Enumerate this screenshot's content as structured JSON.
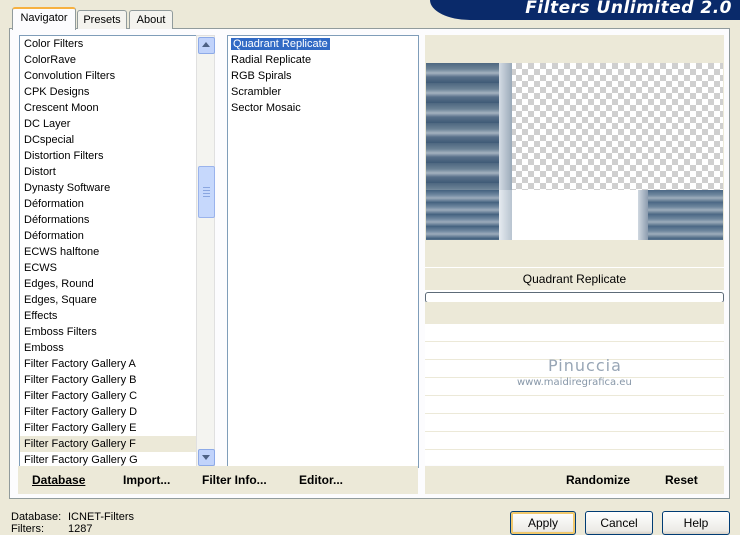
{
  "banner": {
    "title": "Filters Unlimited 2.0"
  },
  "tabs": [
    {
      "label": "Navigator",
      "active": true
    },
    {
      "label": "Presets",
      "active": false
    },
    {
      "label": "About",
      "active": false
    }
  ],
  "categories": [
    "Color Filters",
    "ColorRave",
    "Convolution Filters",
    "CPK Designs",
    "Crescent Moon",
    "DC Layer",
    "DCspecial",
    "Distortion Filters",
    "Distort",
    "Dynasty Software",
    "Déformation",
    "Déformations",
    "Déformation",
    "ECWS halftone",
    "ECWS",
    "Edges, Round",
    "Edges, Square",
    "Effects",
    "Emboss Filters",
    "Emboss",
    "Filter Factory Gallery A",
    "Filter Factory Gallery B",
    "Filter Factory Gallery C",
    "Filter Factory Gallery D",
    "Filter Factory Gallery E",
    "Filter Factory Gallery F",
    "Filter Factory Gallery G"
  ],
  "selected_category": "Filter Factory Gallery F",
  "filters": [
    "Quadrant Replicate",
    "Radial Replicate",
    "RGB Spirals",
    "Scrambler",
    "Sector Mosaic"
  ],
  "selected_filter": "Quadrant Replicate",
  "toolbar": {
    "database": "Database",
    "import": "Import...",
    "filter_info": "Filter Info...",
    "editor": "Editor...",
    "randomize": "Randomize",
    "reset": "Reset"
  },
  "preview": {
    "filter_name": "Quadrant Replicate",
    "progress": 0,
    "watermark_name": "Pinuccia",
    "watermark_url": "www.maidiregrafica.eu"
  },
  "status": {
    "database_label": "Database:",
    "database_value": "ICNET-Filters",
    "filters_label": "Filters:",
    "filters_value": "1287"
  },
  "buttons": {
    "apply": "Apply",
    "cancel": "Cancel",
    "help": "Help"
  }
}
